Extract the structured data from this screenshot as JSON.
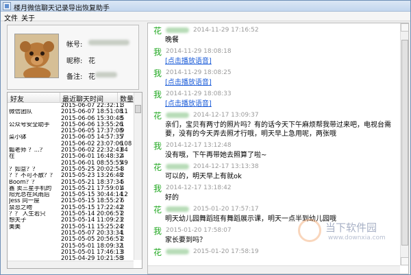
{
  "app": {
    "title": "楼月微信聊天记录导出恢复助手",
    "menu": [
      "文件",
      "关于"
    ]
  },
  "profile": {
    "account_label": "帐号:",
    "nickname_label": "昵称:",
    "nickname_value": "花",
    "remark_label": "备注:",
    "remark_prefix": "花"
  },
  "contacts": {
    "columns": [
      "好友",
      "最近聊天时间",
      "数量"
    ],
    "rows": [
      {
        "name": "",
        "time": "2015-06-07 22:32:11",
        "count": "3"
      },
      {
        "name": "微信团队",
        "time": "2015-06-07 18:51:08",
        "count": "11"
      },
      {
        "name": "",
        "time": "2015-06-06 15:30:48",
        "count": "5"
      },
      {
        "name": "公众号安全助手",
        "time": "2015-06-06 13:55:26",
        "count": "1"
      },
      {
        "name": "",
        "time": "2015-06-05 17:37:08",
        "count": "9"
      },
      {
        "name": "菜小钵",
        "time": "2015-06-05 14:57:35",
        "count": "7"
      },
      {
        "name": "",
        "time": "2015-06-02 23:07:06",
        "count": "108"
      },
      {
        "name": "瓢老师 ？...？",
        "time": "2015-06-02 22:32:43",
        "count": "84"
      },
      {
        "name": "在",
        "time": "2015-06-01 16:48:32",
        "count": "4"
      },
      {
        "name": "",
        "time": "2015-06-01 08:55:55",
        "count": "49"
      },
      {
        "name": "？如意？？",
        "time": "2015-05-25 20:02:54",
        "count": "3"
      },
      {
        "name": "？？不可不散？？",
        "time": "2015-05-23 13:26:48",
        "count": "2"
      },
      {
        "name": "Boom？？",
        "time": "2015-05-21 18:37:34",
        "count": "5"
      },
      {
        "name": "鑫 卖三星手机的",
        "time": "2015-05-21 17:59:01",
        "count": "4"
      },
      {
        "name": "阳光总在风雨后",
        "time": "2015-05-15 30:44:14",
        "count": "12"
      },
      {
        "name": "Jess 同一屋",
        "time": "2015-05-15 18:55:27",
        "count": "6"
      },
      {
        "name": "禁忌之吻",
        "time": "2015-05-15 17:22:42",
        "count": "2"
      },
      {
        "name": "？？ 人生若只",
        "time": "2015-05-14 20:06:57",
        "count": "2"
      },
      {
        "name": "想夫子",
        "time": "2015-05-14 11:09:23",
        "count": "2"
      },
      {
        "name": "美美",
        "time": "2015-05-11 15:25:24",
        "count": "2"
      },
      {
        "name": "",
        "time": "2015-05-07 20:33:34",
        "count": "1"
      },
      {
        "name": "",
        "time": "2015-05-05 20:56:57",
        "count": "2"
      },
      {
        "name": "",
        "time": "2015-05-01 18:09:32",
        "count": "1"
      },
      {
        "name": "",
        "time": "2015-05-01 17:46:13",
        "count": "3"
      },
      {
        "name": "",
        "time": "2015-04-29 10:21:58",
        "count": "3"
      }
    ]
  },
  "chat": {
    "messages": [
      {
        "sender": "花",
        "time": "2014-11-29 17:16:52",
        "body": "晚餐",
        "blur": true
      },
      {
        "sender": "我",
        "time": "2014-11-29 18:08:18",
        "body": "[点击播放语音]",
        "link": true
      },
      {
        "sender": "我",
        "time": "2014-11-29 18:08:25",
        "body": "[点击播放语音]",
        "link": true
      },
      {
        "sender": "我",
        "time": "2014-11-29 18:08:33",
        "body": "[点击播放语音]",
        "link": true
      },
      {
        "sender": "花",
        "time": "2014-12-17 13:09:37",
        "body": "亲们，宝贝有两寸的照片吗？有的话今天下午麻烦帮我带过来吧，电视台需要，没有的今天弄去照才行哦，明天早上急用呢，两张哦",
        "blur": true
      },
      {
        "sender": "我",
        "time": "2014-12-17 13:12:48",
        "body": "没有哦，下午再带她去照算了啦~"
      },
      {
        "sender": "花",
        "time": "2014-12-17 13:13:38",
        "body": "可以的，明天早上有就ok",
        "blur": true
      },
      {
        "sender": "我",
        "time": "2014-12-17 13:18:42",
        "body": "好的"
      },
      {
        "sender": "花",
        "time": "2015-01-20 17:57:17",
        "body": "明天幼儿园舞蹈班有舞蹈展示课，明天一点半到幼儿园哦",
        "blur": true
      },
      {
        "sender": "我",
        "time": "2015-01-20 17:58:07",
        "body": "家长要到吗？"
      },
      {
        "sender": "花",
        "time": "2015-01-20 17:58:19",
        "body": "",
        "blur": true
      }
    ]
  },
  "watermark": {
    "brand": "当下软件园",
    "url": "www.downxia.com"
  }
}
